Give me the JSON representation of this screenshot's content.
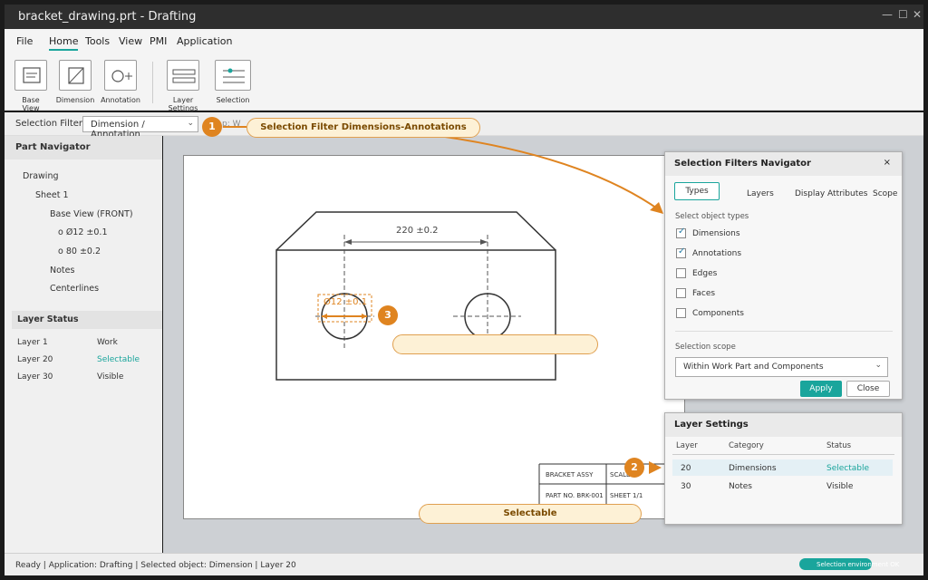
{
  "window": {
    "title": "bracket_drawing.prt - Drafting",
    "minimize": "—",
    "maximize": "☐",
    "close": "✕"
  },
  "menu": [
    "File",
    "Home",
    "Tools",
    "View",
    "PMI",
    "Application"
  ],
  "ribbon": {
    "buttons": [
      "Base View",
      "Dimension",
      "Annotation",
      "Layer Settings",
      "Selection"
    ]
  },
  "filter_bar": {
    "label": "Selection Filter",
    "value": "Dimension / Annotation",
    "ghost": "p: W"
  },
  "part_navigator": {
    "title": "Part Navigator",
    "tree": [
      "Drawing",
      "Sheet 1",
      "Base View (FRONT)",
      "o Ø12 ±0.1",
      "o 80 ±0.2",
      "Notes",
      "Centerlines"
    ]
  },
  "layer_status": {
    "title": "Layer Status",
    "rows": [
      {
        "layer": "Layer 1",
        "state": "Work"
      },
      {
        "layer": "Layer 20",
        "state": "Selectable"
      },
      {
        "layer": "Layer 30",
        "state": "Visible"
      }
    ]
  },
  "drawing": {
    "dim_top": "220 ±0.2",
    "dim_hole": "Ø12 ±0.1",
    "title_block": [
      "BRACKET ASSY",
      "SCALE",
      "PART NO. BRK-001",
      "SHEET 1/1"
    ]
  },
  "callouts": {
    "one": {
      "badge": "1",
      "text": "Selection Filter    Dimensions-Annotations"
    },
    "two": {
      "badge": "2"
    },
    "three": {
      "badge": "3",
      "text": ""
    },
    "bottom": {
      "text": "Selectable"
    }
  },
  "sel_filters": {
    "title": "Selection Filters Navigator",
    "close": "×",
    "tabs": [
      "Types",
      "Layers",
      "Display Attributes",
      "Scope"
    ],
    "section": "Select object types",
    "items": [
      {
        "label": "Dimensions",
        "checked": true
      },
      {
        "label": "Annotations",
        "checked": true
      },
      {
        "label": "Edges",
        "checked": false
      },
      {
        "label": "Faces",
        "checked": false
      },
      {
        "label": "Components",
        "checked": false
      }
    ],
    "scope_label": "Selection scope",
    "scope_value": "Within Work Part and Components",
    "apply": "Apply",
    "close_btn": "Close"
  },
  "layer_settings": {
    "title": "Layer Settings",
    "headers": [
      "Layer",
      "Category",
      "Status"
    ],
    "rows": [
      {
        "layer": "20",
        "category": "Dimensions",
        "status": "Selectable"
      },
      {
        "layer": "30",
        "category": "Notes",
        "status": "Visible"
      }
    ]
  },
  "status_bar": {
    "text": "Ready | Application: Drafting | Selected object: Dimension | Layer 20",
    "pill": "Selection environment OK"
  },
  "colors": {
    "accent": "#1aa59c",
    "callout": "#df8420"
  }
}
